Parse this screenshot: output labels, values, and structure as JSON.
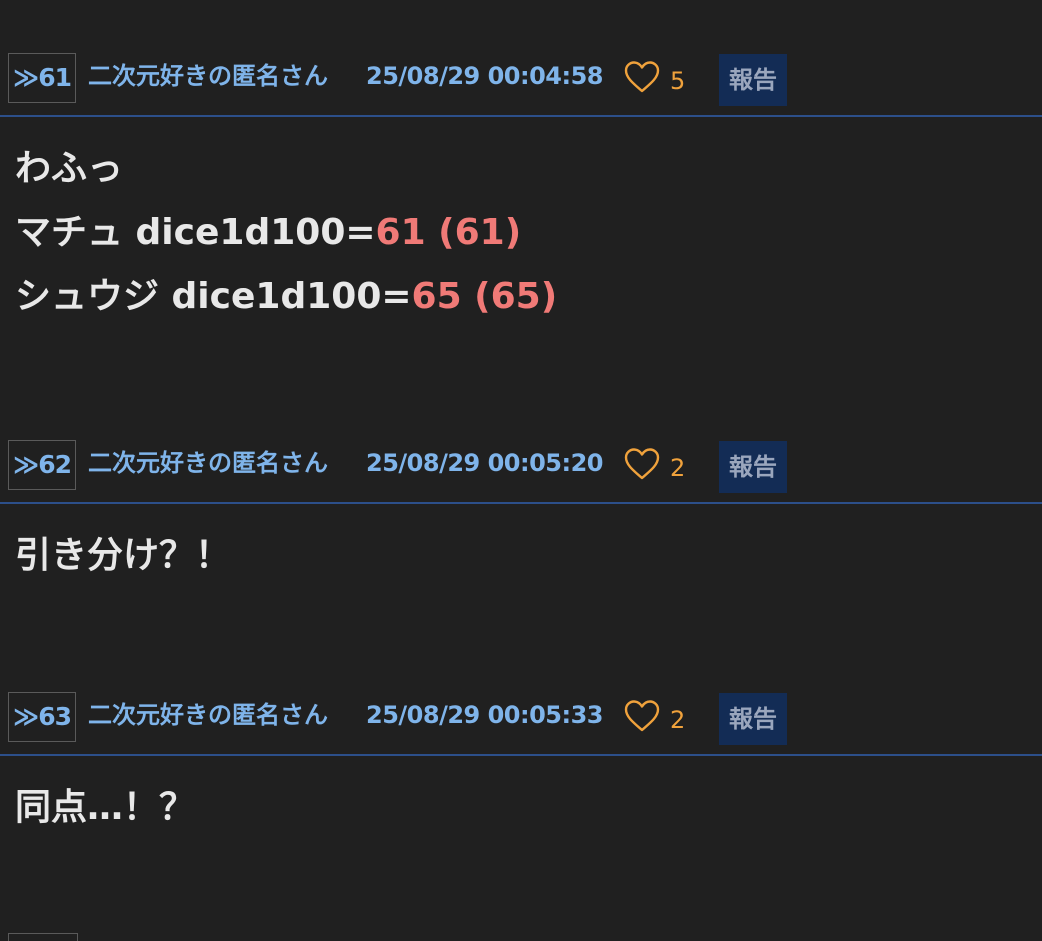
{
  "posts": [
    {
      "number": "≫61",
      "name": "二次元好きの匿名さん",
      "date": "25/08/29 00:04:58",
      "likes": "5",
      "report_label": "報告",
      "lines": [
        {
          "text": "わふっ"
        },
        {
          "text": "マチュ dice1d100=",
          "result": "61 (61)"
        },
        {
          "text": "シュウジ dice1d100=",
          "result": "65 (65)"
        }
      ]
    },
    {
      "number": "≫62",
      "name": "二次元好きの匿名さん",
      "date": "25/08/29 00:05:20",
      "likes": "2",
      "report_label": "報告",
      "lines": [
        {
          "text": "引き分け？！"
        }
      ]
    },
    {
      "number": "≫63",
      "name": "二次元好きの匿名さん",
      "date": "25/08/29 00:05:33",
      "likes": "2",
      "report_label": "報告",
      "lines": [
        {
          "text": "同点…！？"
        }
      ]
    }
  ],
  "colors": {
    "background": "#202020",
    "link": "#7fb4ea",
    "like": "#f0a23c",
    "dice_result": "#f07a77",
    "divider": "#2c4f8a",
    "report_bg": "#132c55"
  },
  "icons": {
    "like": "heart-outline-icon"
  }
}
